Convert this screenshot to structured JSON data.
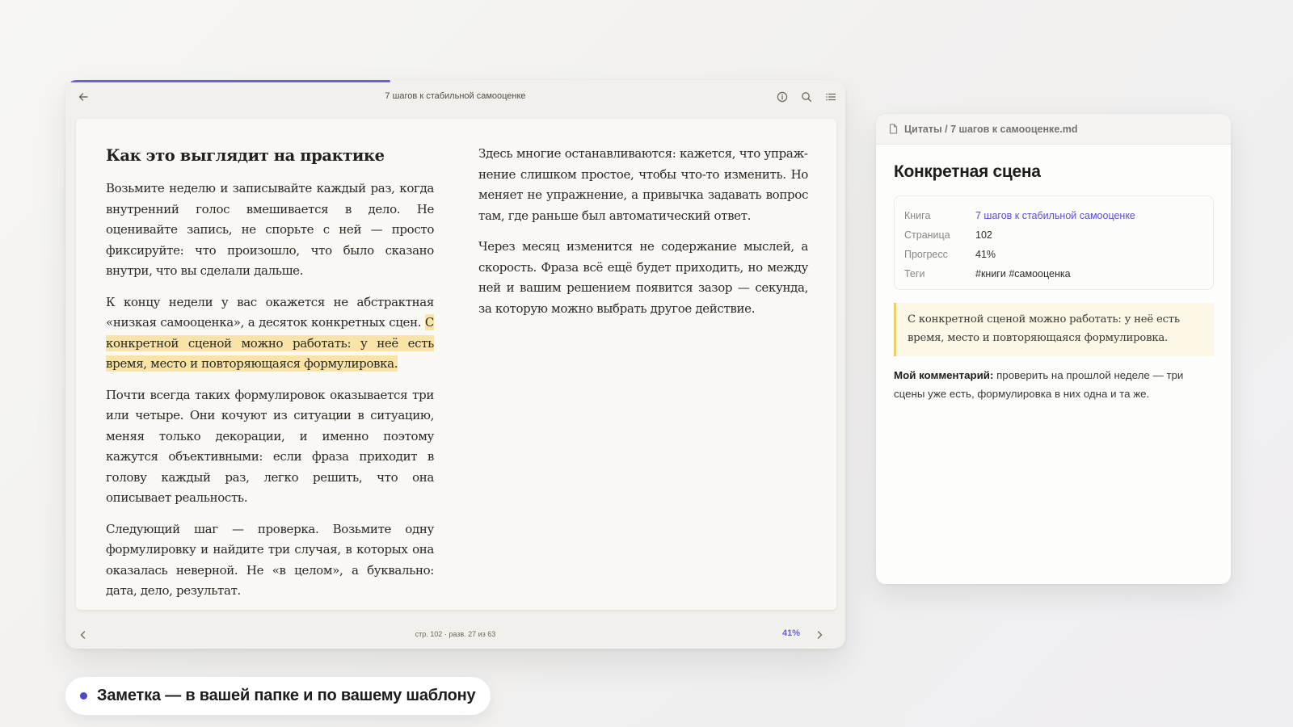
{
  "reader": {
    "title": "7 шагов к стабильной самооценке",
    "progress_fraction": 0.41,
    "left_column": {
      "heading": "Как это выглядит на практике",
      "p1": "Возьмите неделю и записывайте каждый раз, когда внутренний голос вмешивается в дело. Не оценивайте запись, не спорьте с ней — просто фиксируйте: что произошло, что было сказано внутри, что вы сделали дальше.",
      "p2_before": "К концу недели у вас окажется не абстрактная «низкая самооценка», а десяток конкретных сцен. ",
      "p2_highlight": "С конкрет­ной сценой можно работать: у неё есть время, место и повторяющаяся формулировка.",
      "p3": "Почти всегда таких формулировок оказывается три или четыре. Они кочуют из ситуации в ситуацию, ме­няя только декорации, и именно поэтому кажутся объективными: если фраза приходит в голову каждый раз, легко решить, что она описывает реальность.",
      "p4": "Следующий шаг — проверка. Возьмите одну формули­ровку и найдите три случая, в которых она оказалась неверной. Не «в целом», а буквально: дата, дело, результат."
    },
    "right_column": {
      "p1": "Здесь многие останавливаются: кажется, что упраж­нение слишком простое, чтобы что-то изменить. Но меняет не упражнение, а привычка задавать вопрос там, где раньше был автоматический ответ.",
      "p2": "Через месяц изменится не содержание мыслей, а ско­рость. Фраза всё ещё будет приходить, но между ней и вашим решением появится зазор — секунда, за кото­рую можно выбрать другое действие."
    },
    "footer": {
      "page_info": "стр. 102 · разв. 27 из 63",
      "percent": "41%"
    },
    "icons": {
      "back": "arrow-left-icon",
      "info": "info-icon",
      "search": "search-icon",
      "toc": "list-icon",
      "prev": "chevron-left-icon",
      "next": "chevron-right-icon"
    },
    "accent_color": "#6a5fd6",
    "highlight_color": "#f9e3a6"
  },
  "note": {
    "path": "Цитаты / 7 шагов к самооценке.md",
    "title": "Конкретная сцена",
    "props": [
      {
        "key": "Книга",
        "value": "7 шагов к стабильной самооценке"
      },
      {
        "key": "Страница",
        "value": "102"
      },
      {
        "key": "Прогресс",
        "value": "41%"
      },
      {
        "key": "Теги",
        "value": "#книги #самооценка"
      }
    ],
    "quote": "С конкретной сценой можно работать: у неё есть время, место и повторяющаяся формулировка.",
    "comment_label": "Мой комментарий:",
    "comment_text": " проверить на прошлой неделе — три сцены уже есть, формулировка в них одна и та же."
  },
  "caption": {
    "text": "Заметка — в вашей папке и по вашему шаблону",
    "dot_color": "#5047c8"
  }
}
